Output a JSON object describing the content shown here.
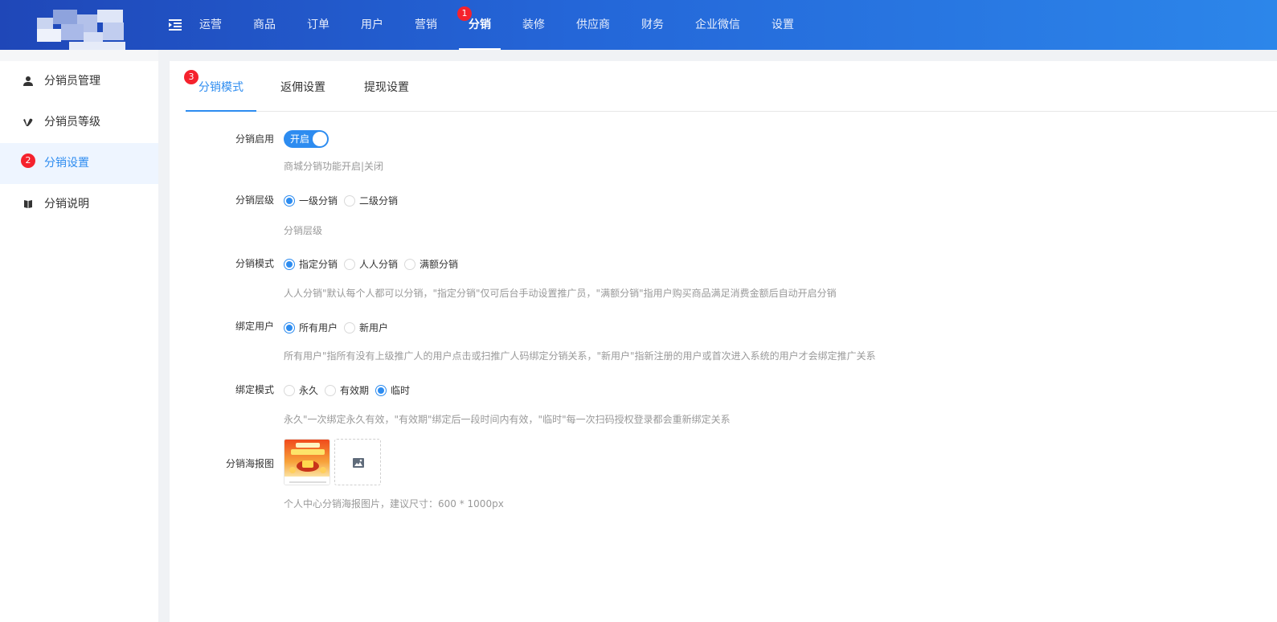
{
  "header": {
    "nav": [
      {
        "label": "运营"
      },
      {
        "label": "商品"
      },
      {
        "label": "订单"
      },
      {
        "label": "用户"
      },
      {
        "label": "营销"
      },
      {
        "label": "分销",
        "active": true,
        "badge": "1"
      },
      {
        "label": "装修"
      },
      {
        "label": "供应商"
      },
      {
        "label": "财务"
      },
      {
        "label": "企业微信"
      },
      {
        "label": "设置"
      }
    ]
  },
  "sidebar": {
    "badge": "2",
    "items": [
      {
        "label": "分销员管理",
        "icon": "user-icon"
      },
      {
        "label": "分销员等级",
        "icon": "vimeo-v-icon"
      },
      {
        "label": "分销设置",
        "icon": "settings-icon",
        "active": true
      },
      {
        "label": "分销说明",
        "icon": "book-icon"
      }
    ]
  },
  "tabs": {
    "badge": "3",
    "items": [
      {
        "label": "分销模式",
        "active": true
      },
      {
        "label": "返佣设置"
      },
      {
        "label": "提现设置"
      }
    ]
  },
  "form": {
    "enable": {
      "label": "分销启用",
      "switch_text": "开启",
      "on": true,
      "hint": "商城分销功能开启|关闭"
    },
    "level": {
      "label": "分销层级",
      "options": [
        "一级分销",
        "二级分销"
      ],
      "selected": 0,
      "hint": "分销层级"
    },
    "mode": {
      "label": "分销模式",
      "options": [
        "指定分销",
        "人人分销",
        "满额分销"
      ],
      "selected": 0,
      "hint": "人人分销\"默认每个人都可以分销，\"指定分销\"仅可后台手动设置推广员，\"满额分销\"指用户购买商品满足消费金额后自动开启分销"
    },
    "bind_user": {
      "label": "绑定用户",
      "options": [
        "所有用户",
        "新用户"
      ],
      "selected": 0,
      "hint": "所有用户\"指所有没有上级推广人的用户点击或扫推广人码绑定分销关系，\"新用户\"指新注册的用户或首次进入系统的用户才会绑定推广关系"
    },
    "bind_mode": {
      "label": "绑定模式",
      "options": [
        "永久",
        "有效期",
        "临时"
      ],
      "selected": 2,
      "hint": "永久\"一次绑定永久有效，\"有效期\"绑定后一段时间内有效，\"临时\"每一次扫码授权登录都会重新绑定关系"
    },
    "poster": {
      "label": "分销海报图",
      "hint": "个人中心分销海报图片，建议尺寸：600 * 1000px"
    }
  },
  "colors": {
    "primary": "#2d8cf0",
    "badge": "#f5222d"
  }
}
